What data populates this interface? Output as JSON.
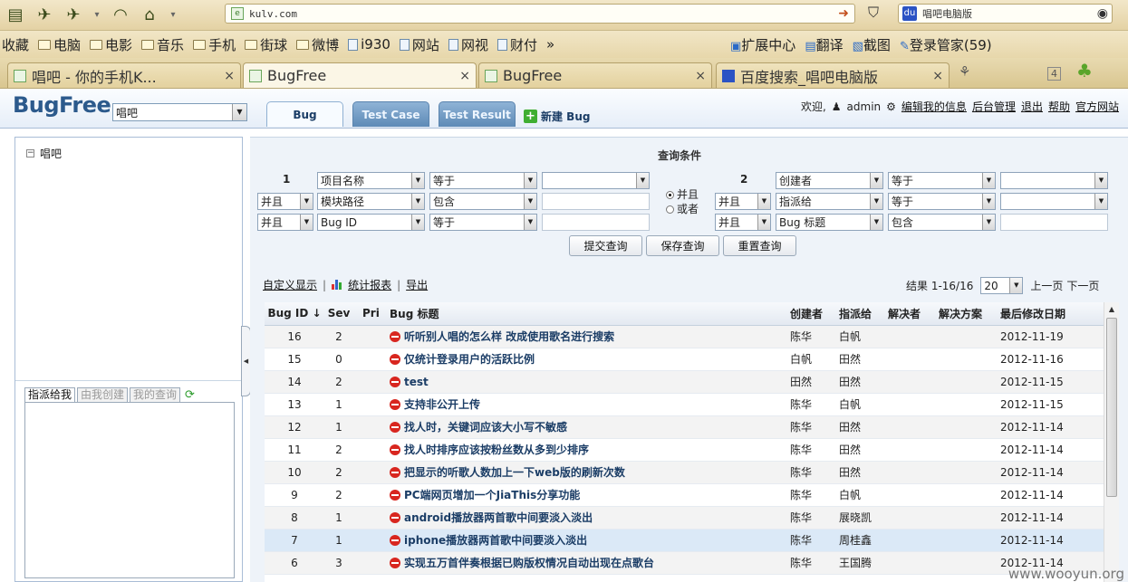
{
  "browser": {
    "url_host": "kulv.com",
    "search_text": "唱吧电脑版",
    "bookmarks": [
      {
        "label": "收藏",
        "type": "text"
      },
      {
        "label": "电脑",
        "type": "folder"
      },
      {
        "label": "电影",
        "type": "folder"
      },
      {
        "label": "音乐",
        "type": "folder"
      },
      {
        "label": "手机",
        "type": "folder"
      },
      {
        "label": "街球",
        "type": "folder"
      },
      {
        "label": "微博",
        "type": "folder"
      },
      {
        "label": "i930",
        "type": "page"
      },
      {
        "label": "网站",
        "type": "page"
      },
      {
        "label": "网视",
        "type": "page"
      },
      {
        "label": "财付",
        "type": "page"
      }
    ],
    "bookmarks_more": "»",
    "toolbar_right": [
      "扩展中心",
      "翻译",
      "截图",
      "登录管家(59)"
    ],
    "tabs": [
      {
        "label": "唱吧 - 你的手机K...",
        "active": false,
        "icon": "page"
      },
      {
        "label": "BugFree",
        "active": true,
        "icon": "page"
      },
      {
        "label": "BugFree",
        "active": false,
        "icon": "page"
      },
      {
        "label": "百度搜索_唱吧电脑版",
        "active": false,
        "icon": "baidu"
      }
    ],
    "tab_close": "×",
    "tab_count": "4"
  },
  "header": {
    "logo": "BugFree",
    "project": "唱吧",
    "tabs": [
      "Bug",
      "Test Case",
      "Test Result"
    ],
    "new_bug": "新建 Bug",
    "welcome": "欢迎,",
    "user": "admin",
    "links": [
      "编辑我的信息",
      "后台管理",
      "退出",
      "帮助",
      "官方网站"
    ]
  },
  "left": {
    "tree_root": "唱吧",
    "sub_tabs": [
      "指派给我",
      "由我创建",
      "我的查询"
    ]
  },
  "query": {
    "title": "查询条件",
    "group1_num": "1",
    "group2_num": "2",
    "rows_left": [
      {
        "logic": "",
        "field": "项目名称",
        "op": "等于",
        "value": "",
        "value_is_select": true
      },
      {
        "logic": "并且",
        "field": "模块路径",
        "op": "包含",
        "value": "",
        "value_is_select": false
      },
      {
        "logic": "并且",
        "field": "Bug ID",
        "op": "等于",
        "value": "",
        "value_is_select": false
      }
    ],
    "rows_right": [
      {
        "logic": "",
        "field": "创建者",
        "op": "等于",
        "value": "",
        "value_is_select": true
      },
      {
        "logic": "并且",
        "field": "指派给",
        "op": "等于",
        "value": "",
        "value_is_select": true
      },
      {
        "logic": "并且",
        "field": "Bug 标题",
        "op": "包含",
        "value": "",
        "value_is_select": false
      }
    ],
    "radio_and": "并且",
    "radio_or": "或者",
    "buttons": [
      "提交查询",
      "保存查询",
      "重置查询"
    ]
  },
  "results": {
    "links": [
      "自定义显示",
      "统计报表",
      "导出"
    ],
    "range": "结果 1-16/16",
    "page_size": "20",
    "prev": "上一页",
    "next": "下一页",
    "columns": [
      "Bug ID ↓",
      "Sev",
      "Pri",
      "Bug 标题",
      "创建者",
      "指派给",
      "解决者",
      "解决方案",
      "最后修改日期"
    ],
    "rows": [
      {
        "id": "16",
        "sev": "2",
        "pri": "",
        "title": "听听别人唱的怎么样 改成使用歌名进行搜索",
        "creator": "陈华",
        "assignee": "白帆",
        "resolver": "",
        "resolution": "",
        "date": "2012-11-19"
      },
      {
        "id": "15",
        "sev": "0",
        "pri": "",
        "title": "仅统计登录用户的活跃比例",
        "creator": "白帆",
        "assignee": "田然",
        "resolver": "",
        "resolution": "",
        "date": "2012-11-16"
      },
      {
        "id": "14",
        "sev": "2",
        "pri": "",
        "title": "test",
        "creator": "田然",
        "assignee": "田然",
        "resolver": "",
        "resolution": "",
        "date": "2012-11-15"
      },
      {
        "id": "13",
        "sev": "1",
        "pri": "",
        "title": "支持非公开上传",
        "creator": "陈华",
        "assignee": "白帆",
        "resolver": "",
        "resolution": "",
        "date": "2012-11-15"
      },
      {
        "id": "12",
        "sev": "1",
        "pri": "",
        "title": "找人时，关键词应该大小写不敏感",
        "creator": "陈华",
        "assignee": "田然",
        "resolver": "",
        "resolution": "",
        "date": "2012-11-14"
      },
      {
        "id": "11",
        "sev": "2",
        "pri": "",
        "title": "找人时排序应该按粉丝数从多到少排序",
        "creator": "陈华",
        "assignee": "田然",
        "resolver": "",
        "resolution": "",
        "date": "2012-11-14"
      },
      {
        "id": "10",
        "sev": "2",
        "pri": "",
        "title": "把显示的听歌人数加上一下web版的刷新次数",
        "creator": "陈华",
        "assignee": "田然",
        "resolver": "",
        "resolution": "",
        "date": "2012-11-14"
      },
      {
        "id": "9",
        "sev": "2",
        "pri": "",
        "title": "PC端网页增加一个JiaThis分享功能",
        "creator": "陈华",
        "assignee": "白帆",
        "resolver": "",
        "resolution": "",
        "date": "2012-11-14"
      },
      {
        "id": "8",
        "sev": "1",
        "pri": "",
        "title": "android播放器两首歌中间要淡入淡出",
        "creator": "陈华",
        "assignee": "展晓凯",
        "resolver": "",
        "resolution": "",
        "date": "2012-11-14"
      },
      {
        "id": "7",
        "sev": "1",
        "pri": "",
        "title": "iphone播放器两首歌中间要淡入淡出",
        "creator": "陈华",
        "assignee": "周桂鑫",
        "resolver": "",
        "resolution": "",
        "date": "2012-11-14"
      },
      {
        "id": "6",
        "sev": "3",
        "pri": "",
        "title": "实现五万首伴奏根据已购版权情况自动出现在点歌台",
        "creator": "陈华",
        "assignee": "王国腾",
        "resolver": "",
        "resolution": "",
        "date": "2012-11-14"
      }
    ]
  },
  "watermark": "www.wooyun.org",
  "colors": {
    "accent": "#2c5a8c",
    "title_link": "#1b3d66",
    "highlight_row": "#dbe9f7",
    "stop_icon": "#d8261f"
  }
}
